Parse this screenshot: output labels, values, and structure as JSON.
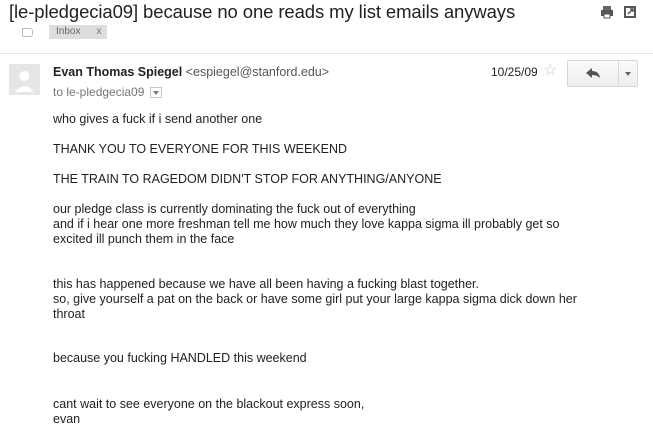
{
  "email": {
    "subject": "[le-pledgecia09] because no one reads my list emails anyways",
    "labels": [
      {
        "name": "Inbox",
        "remove": "x"
      }
    ],
    "sender_name": "Evan Thomas Spiegel",
    "sender_email": "<espiegel@stanford.edu>",
    "to": "to le-pledgecia09",
    "date": "10/25/09",
    "body_lines": [
      "who gives a fuck if i send another one",
      "THANK YOU TO EVERYONE FOR THIS WEEKEND",
      "THE TRAIN TO RAGEDOM DIDN'T STOP FOR ANYTHING/ANYONE",
      "our pledge class is currently dominating the fuck out of everything",
      "and if i hear one more freshman tell me how much they love kappa sigma ill probably get so",
      "excited ill punch them in the face",
      "this has happened because we have all been having a fucking blast together.",
      "so, give yourself a pat on the back or have some girl put your large kappa sigma dick down her",
      "throat",
      "because you fucking HANDLED this weekend",
      "cant wait to see everyone on the blackout express soon,",
      "evan"
    ]
  },
  "icons": {
    "print": "print-icon",
    "new_window": "new-window-icon",
    "label": "label-icon",
    "avatar": "person-icon",
    "star": "star-icon",
    "reply": "reply-arrow-icon",
    "more": "chevron-down-icon",
    "details": "details-dropdown-icon"
  },
  "colors": {
    "text": "#222222",
    "muted": "#777777",
    "chip_bg": "#dddddd"
  }
}
